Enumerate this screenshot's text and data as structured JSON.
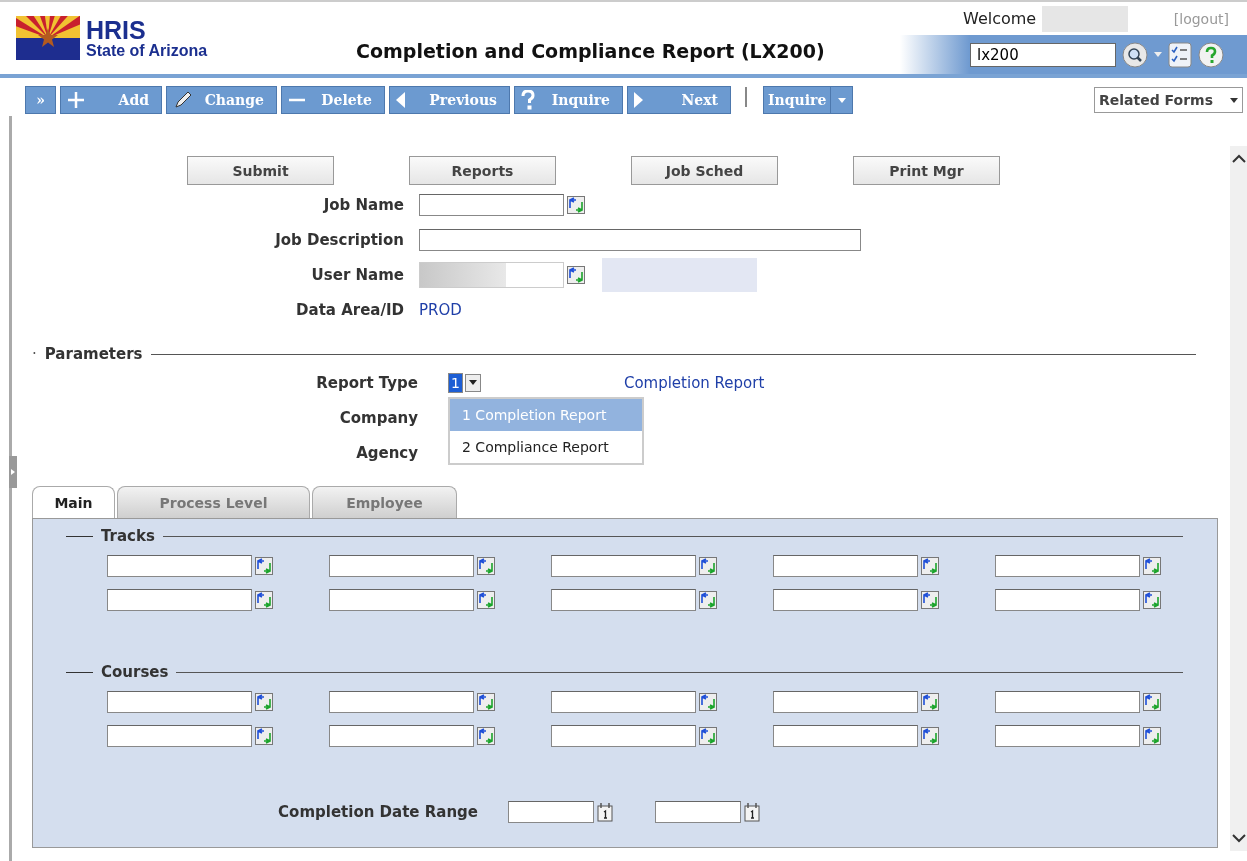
{
  "header": {
    "app_name": "HRIS",
    "subtitle": "State of Arizona",
    "title": "Completion and Compliance Report (LX200)",
    "welcome": "Welcome",
    "logout": "[logout]",
    "search": {
      "value": "lx200"
    }
  },
  "toolbar": {
    "buttons": [
      {
        "kind": "expand",
        "label": "»"
      },
      {
        "kind": "add",
        "label": "Add"
      },
      {
        "kind": "change",
        "label": "Change"
      },
      {
        "kind": "delete",
        "label": "Delete"
      },
      {
        "kind": "previous",
        "label": "Previous"
      },
      {
        "kind": "inquire",
        "label": "Inquire"
      },
      {
        "kind": "next",
        "label": "Next"
      }
    ],
    "menu_button": "Inquire",
    "related_forms": "Related Forms"
  },
  "action_buttons": [
    "Submit",
    "Reports",
    "Job Sched",
    "Print Mgr"
  ],
  "job_fields": [
    {
      "kind": "select",
      "label": "Job Name"
    },
    {
      "kind": "wide",
      "label": "Job Description"
    },
    {
      "kind": "redacted",
      "label": "User Name"
    },
    {
      "kind": "text",
      "label": "Data Area/ID",
      "value": "PROD"
    }
  ],
  "parameters": {
    "marker": "·",
    "title": "Parameters",
    "report_type": {
      "label": "Report Type",
      "value": "1",
      "description": "Completion Report",
      "options": [
        {
          "label": "1 Completion Report",
          "selected": true
        },
        {
          "label": "2 Compliance Report",
          "selected": false
        }
      ]
    },
    "other_labels": [
      "Company",
      "Agency"
    ]
  },
  "tabs": [
    {
      "label": "Main",
      "selected": true
    },
    {
      "label": "Process Level",
      "selected": false
    },
    {
      "label": "Employee",
      "selected": false
    }
  ],
  "groups": [
    {
      "title": "Tracks"
    },
    {
      "title": "Courses"
    }
  ],
  "date_range": {
    "label": "Completion Date Range"
  }
}
